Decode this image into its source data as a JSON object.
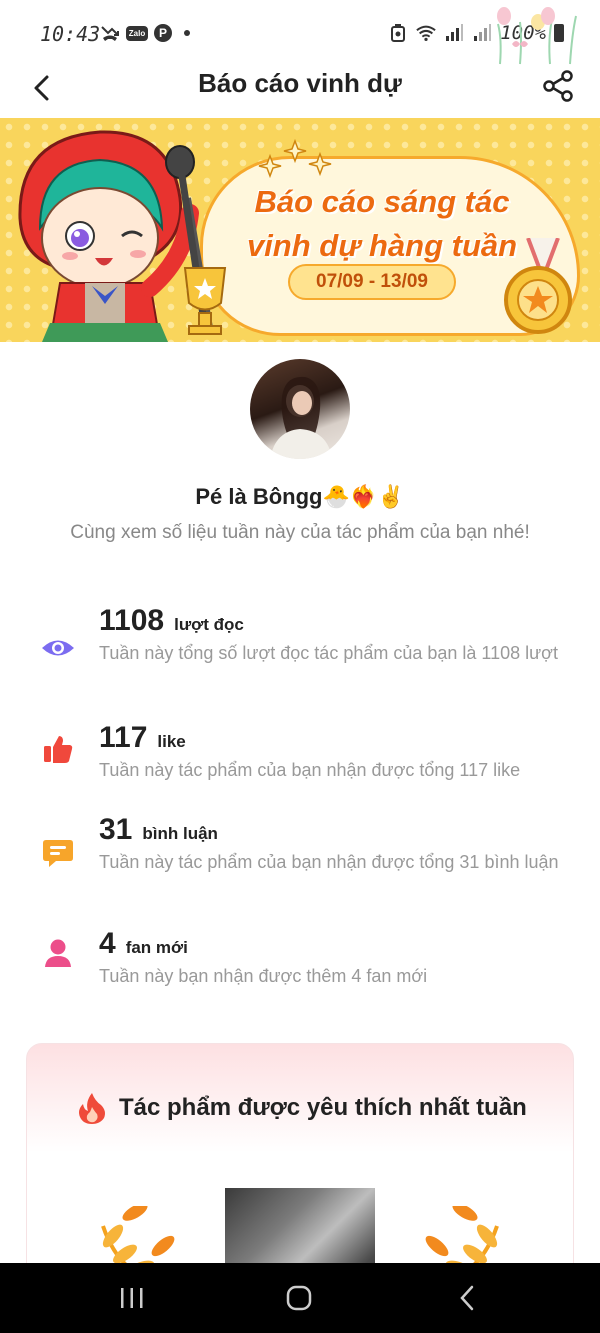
{
  "status_bar": {
    "time": "10:43",
    "zalo_label": "Zalo",
    "battery": "100%",
    "icons": [
      "missed-call-icon",
      "zalo-icon",
      "pinterest-icon",
      "recycle-icon",
      "wifi-icon",
      "signal-icon",
      "signal-icon-2",
      "battery-icon"
    ]
  },
  "nav": {
    "title": "Báo cáo vinh dự",
    "back_icon": "chevron-left-icon",
    "share_icon": "share-icon"
  },
  "banner": {
    "title_line1": "Báo cáo sáng tác",
    "title_line2": "vinh dự hàng tuần",
    "date_range": "07/09 - 13/09"
  },
  "profile": {
    "name": "Pé là Bôngg",
    "name_emojis": "🐣❤️‍🔥✌️",
    "subtitle": "Cùng xem số liệu tuần này của tác phẩm của bạn nhé!"
  },
  "stats": [
    {
      "icon": "eye-icon",
      "number": "1108",
      "unit": "lượt đọc",
      "desc": "Tuần này tổng số lượt đọc tác phẩm của bạn là 1108 lượt"
    },
    {
      "icon": "thumbs-up-icon",
      "number": "117",
      "unit": "like",
      "desc": "Tuần này tác phẩm của bạn nhận được tổng 117 like"
    },
    {
      "icon": "comment-icon",
      "number": "31",
      "unit": "bình luận",
      "desc": "Tuần này tác phẩm của bạn nhận được tổng 31 bình luận"
    },
    {
      "icon": "user-icon",
      "number": "4",
      "unit": "fan mới",
      "desc": "Tuần này bạn nhận được thêm 4 fan mới"
    }
  ],
  "favorite": {
    "title": "Tác phẩm được yêu thích nhất tuần",
    "icon": "fire-icon"
  },
  "colors": {
    "eye": "#7b6cf0",
    "thumb": "#f0483c",
    "comment": "#f7a52a",
    "user": "#ec4e8a",
    "banner_text": "#ec6a10"
  }
}
